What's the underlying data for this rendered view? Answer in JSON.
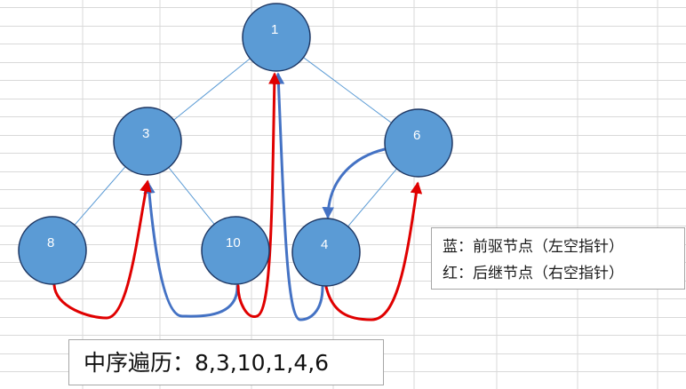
{
  "nodes": [
    {
      "id": "n1",
      "label": "1"
    },
    {
      "id": "n3",
      "label": "3"
    },
    {
      "id": "n6",
      "label": "6"
    },
    {
      "id": "n8",
      "label": "8"
    },
    {
      "id": "n10",
      "label": "10"
    },
    {
      "id": "n4",
      "label": "4"
    }
  ],
  "tree_edges": [
    {
      "from": "n1",
      "to": "n3"
    },
    {
      "from": "n1",
      "to": "n6"
    },
    {
      "from": "n3",
      "to": "n8"
    },
    {
      "from": "n3",
      "to": "n10"
    },
    {
      "from": "n6",
      "to": "n4"
    }
  ],
  "thread_arrows": [
    {
      "from": "n10",
      "to": "n3",
      "kind": "predecessor"
    },
    {
      "from": "n4",
      "to": "n1",
      "kind": "predecessor"
    },
    {
      "from": "n6",
      "to": "n4",
      "kind": "predecessor"
    },
    {
      "from": "n8",
      "to": "n3",
      "kind": "successor"
    },
    {
      "from": "n10",
      "to": "n1",
      "kind": "successor"
    },
    {
      "from": "n4",
      "to": "n6",
      "kind": "successor"
    }
  ],
  "legend": {
    "blue": "蓝：前驱节点（左空指针）",
    "red": "红：后继节点（右空指针）"
  },
  "result": "中序遍历：8,3,10,1,4,6",
  "colors": {
    "node_fill": "#5b9bd5",
    "node_stroke": "#1f3864",
    "tree_edge": "#5b9bd5",
    "predecessor_arrow": "#4472c4",
    "successor_arrow": "#e00000",
    "grid": "#d9d9d9"
  }
}
